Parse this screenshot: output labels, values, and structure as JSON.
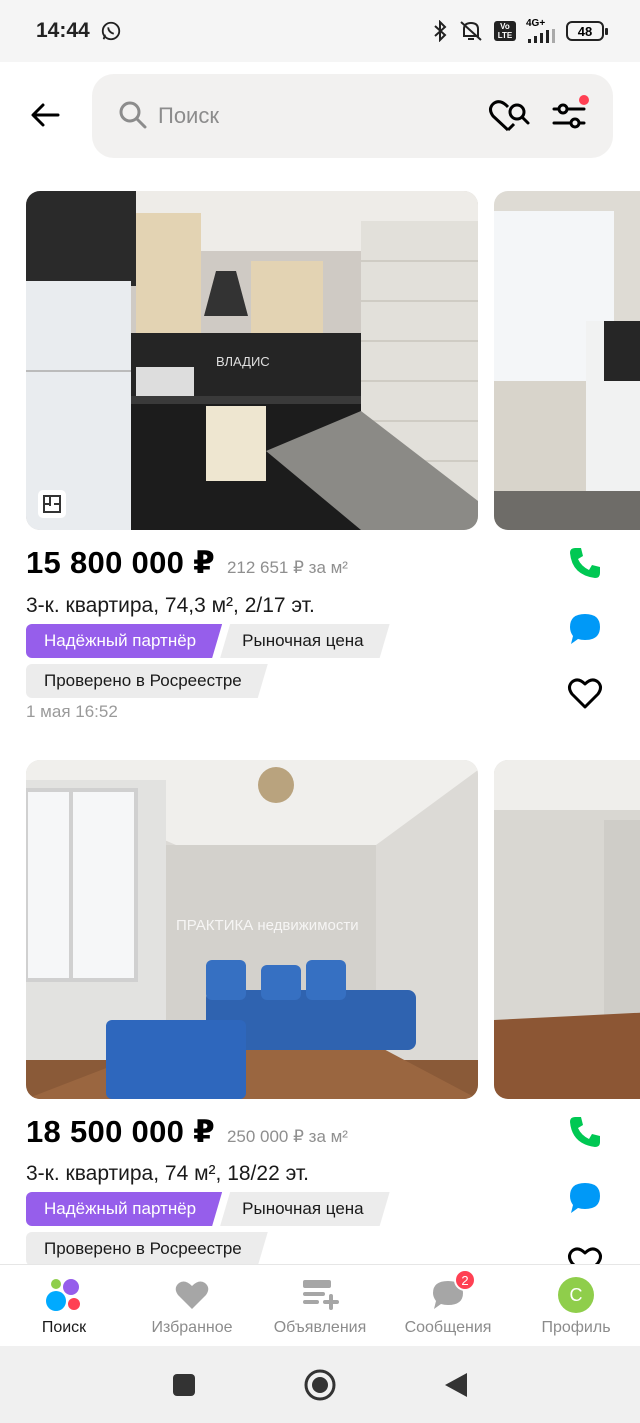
{
  "status_bar": {
    "time": "14:44",
    "network": "4G+",
    "volte": "Vo LTE",
    "battery": "48"
  },
  "search": {
    "placeholder": "Поиск"
  },
  "listings": [
    {
      "price": "15 800 000 ₽",
      "price_per_m": "212 651 ₽ за м²",
      "title": "3-к. квартира, 74,3 м², 2/17 эт.",
      "tags": [
        "Надёжный партнёр",
        "Рыночная цена"
      ],
      "verified": "Проверено в Росреестре",
      "date": "1 мая 16:52",
      "watermark": "ВЛАДИС"
    },
    {
      "price": "18 500 000 ₽",
      "price_per_m": "250 000 ₽ за м²",
      "title": "3-к. квартира, 74 м², 18/22 эт.",
      "tags": [
        "Надёжный партнёр",
        "Рыночная цена"
      ],
      "verified": "Проверено в Росреестре",
      "watermark": "ПРАКТИКА недвижимости"
    }
  ],
  "bottom_nav": {
    "items": [
      {
        "label": "Поиск",
        "icon": "avito-logo-icon"
      },
      {
        "label": "Избранное",
        "icon": "heart-icon"
      },
      {
        "label": "Объявления",
        "icon": "listings-add-icon"
      },
      {
        "label": "Сообщения",
        "icon": "chat-icon",
        "badge": "2"
      },
      {
        "label": "Профиль",
        "icon": "avatar",
        "avatar_letter": "С"
      }
    ]
  },
  "colors": {
    "accent_purple": "#965eeb",
    "call_green": "#00c853",
    "chat_blue": "#0099f7",
    "badge_red": "#ff4053",
    "avatar_green": "#8fce4b"
  }
}
